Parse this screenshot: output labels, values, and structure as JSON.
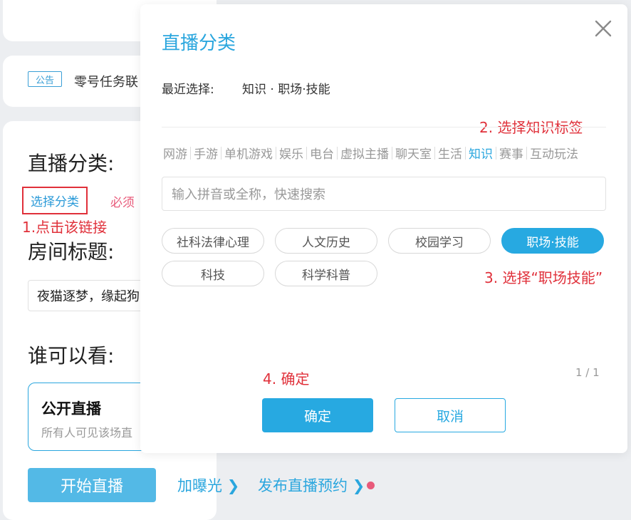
{
  "background": {
    "notice_badge": "公告",
    "notice_text": "零号任务联",
    "category_label": "直播分类:",
    "select_category_link": "选择分类",
    "required_hint": "必须",
    "room_title_label": "房间标题:",
    "room_title_value": "夜猫逐梦，缘起狗",
    "who_can_view_label": "谁可以看:",
    "public_live_title": "公开直播",
    "public_live_desc": "所有人可见该场直",
    "start_button": "开始直播",
    "exposure_link": "加曝光",
    "schedule_link": "发布直播预约",
    "chevron": "❯"
  },
  "annotations": {
    "step1": "1.点击该链接",
    "step2": "2. 选择知识标签",
    "step3": "3. 选择“职场技能”",
    "step4": "4. 确定"
  },
  "modal": {
    "title": "直播分类",
    "recent_label": "最近选择:",
    "recent_value": "知识 · 职场·技能",
    "tabs": [
      "网游",
      "手游",
      "单机游戏",
      "娱乐",
      "电台",
      "虚拟主播",
      "聊天室",
      "生活",
      "知识",
      "赛事",
      "互动玩法"
    ],
    "active_tab": "知识",
    "search_placeholder": "输入拼音或全称，快速搜索",
    "tags": [
      "社科法律心理",
      "人文历史",
      "校园学习",
      "职场·技能",
      "科技",
      "科学科普"
    ],
    "selected_tag": "职场·技能",
    "pager": "1 / 1",
    "confirm_button": "确定",
    "cancel_button": "取消"
  },
  "colors": {
    "accent": "#27a9e1",
    "annotation_red": "#e0303a",
    "required_pink": "#e85a7a"
  }
}
